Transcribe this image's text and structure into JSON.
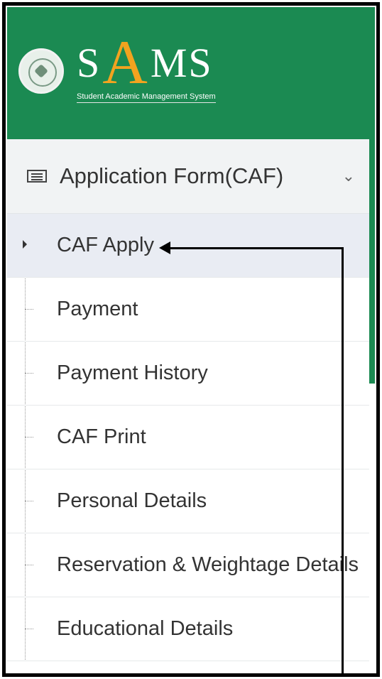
{
  "brand": {
    "prefix": "S",
    "accent": "A",
    "suffix": "MS",
    "tagline": "Student Academic Management System"
  },
  "menu": {
    "title": "Application Form(CAF)",
    "expanded_icon": "chevron-down-icon",
    "items": [
      {
        "label": "CAF Apply"
      },
      {
        "label": "Payment"
      },
      {
        "label": "Payment History"
      },
      {
        "label": "CAF Print"
      },
      {
        "label": "Personal Details"
      },
      {
        "label": "Reservation & Weightage Details"
      },
      {
        "label": "Educational Details"
      }
    ],
    "active_item": "CAF Apply"
  },
  "colors": {
    "header_green": "#1b8a52",
    "logo_accent": "#f2a31f",
    "active_row": "#e9ecf3"
  }
}
